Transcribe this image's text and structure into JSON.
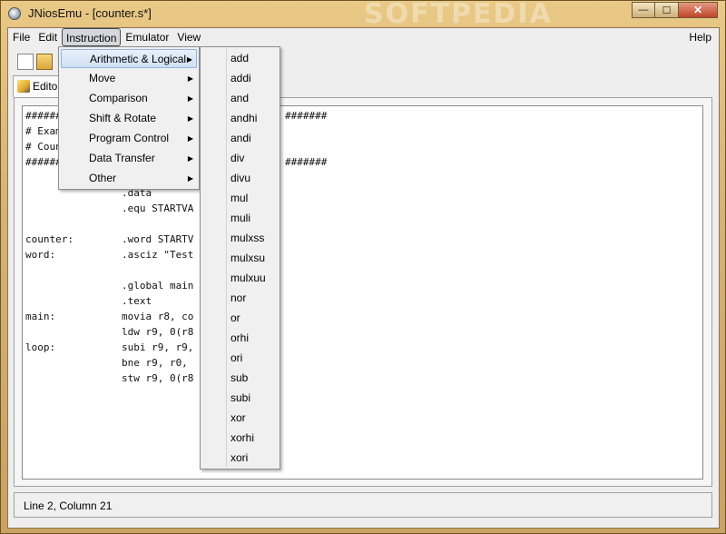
{
  "window": {
    "title": "JNiosEmu - [counter.s*]",
    "watermark": "SOFTPEDIA"
  },
  "menubar": {
    "items": [
      "File",
      "Edit",
      "Instruction",
      "Emulator",
      "View"
    ],
    "help": "Help"
  },
  "tabs": [
    {
      "label": "Edito"
    }
  ],
  "instruction_menu": {
    "items": [
      {
        "label": "Arithmetic & Logical"
      },
      {
        "label": "Move"
      },
      {
        "label": "Comparison"
      },
      {
        "label": "Shift & Rotate"
      },
      {
        "label": "Program Control"
      },
      {
        "label": "Data Transfer"
      },
      {
        "label": "Other"
      }
    ]
  },
  "arith_submenu": {
    "items": [
      "add",
      "addi",
      "and",
      "andhi",
      "andi",
      "div",
      "divu",
      "mul",
      "muli",
      "mulxss",
      "mulxsu",
      "mulxuu",
      "nor",
      "or",
      "orhi",
      "ori",
      "sub",
      "subi",
      "xor",
      "xorhi",
      "xori"
    ]
  },
  "editor": {
    "lines": [
      "######",
      "# Exam",
      "# Coun",
      "######",
      "                .data",
      "                .equ STARTVA",
      "",
      "counter:        .word STARTV",
      "word:           .asciz \"Test",
      "",
      "                .global main",
      "                .text",
      "main:           movia r8, co",
      "                ldw r9, 0(r8",
      "loop:           subi r9, r9,",
      "                bne r9, r0,",
      "                stw r9, 0(r8"
    ],
    "right_hash_1": "#######",
    "right_hash_2": "#######"
  },
  "status": {
    "text": "Line 2, Column 21"
  },
  "icons": {
    "title": "app-icon",
    "min": "minimize-icon",
    "max": "maximize-icon",
    "close": "close-icon",
    "new": "new-file-icon",
    "open": "open-folder-icon",
    "pencil": "pencil-icon",
    "arrow": "submenu-arrow-icon"
  }
}
